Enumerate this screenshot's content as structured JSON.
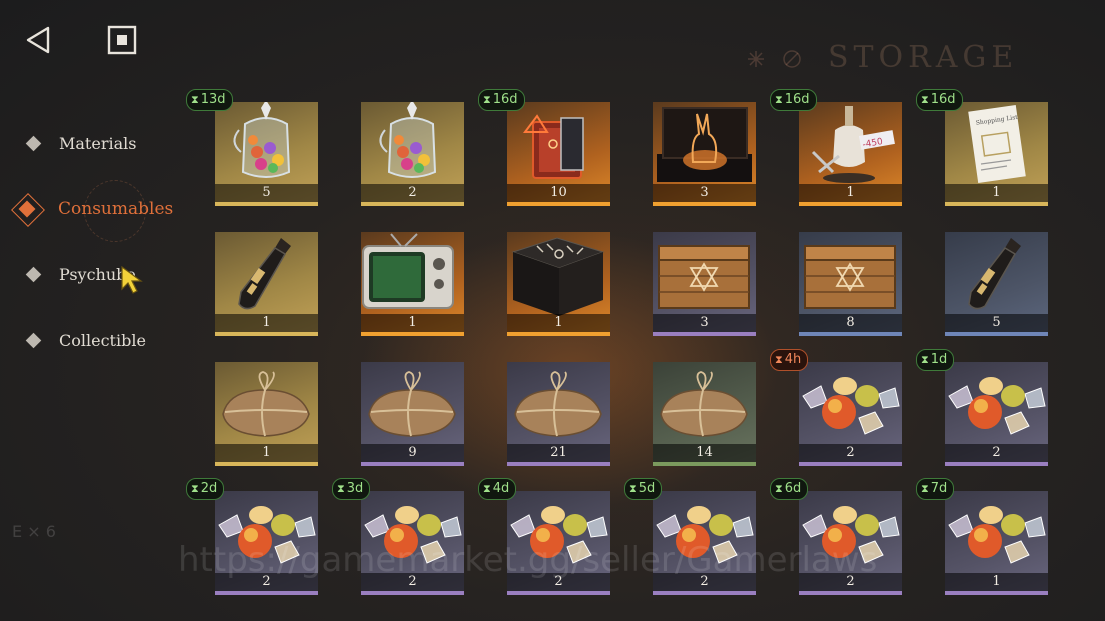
{
  "header": {
    "title": "STORAGE"
  },
  "top_buttons": {
    "back_icon": "back-triangle-icon",
    "stop_icon": "square-stop-icon"
  },
  "nav": {
    "items": [
      {
        "label": "Materials",
        "active": false
      },
      {
        "label": "Consumables",
        "active": true
      },
      {
        "label": "Psychube",
        "active": false
      },
      {
        "label": "Collectible",
        "active": false
      }
    ],
    "accent": "#e0703a"
  },
  "watermark": "https://gamemarket.gg/seller/Gamerlaws",
  "items": [
    {
      "icon": "candy-jar-icon",
      "qty": "5",
      "rarity": "gold",
      "timer": "13d"
    },
    {
      "icon": "candy-jar-icon",
      "qty": "2",
      "rarity": "gold",
      "timer": ""
    },
    {
      "icon": "spellbook-icon",
      "qty": "10",
      "rarity": "orange",
      "timer": "16d"
    },
    {
      "icon": "rabbit-figure-box-icon",
      "qty": "3",
      "rarity": "orange",
      "timer": ""
    },
    {
      "icon": "mannequin-icon",
      "qty": "1",
      "rarity": "orange",
      "timer": "16d"
    },
    {
      "icon": "shopping-list-ticket-icon",
      "qty": "1",
      "rarity": "gold",
      "timer": "16d"
    },
    {
      "icon": "message-bottle-icon",
      "qty": "1",
      "rarity": "gold",
      "timer": ""
    },
    {
      "icon": "retro-tv-icon",
      "qty": "1",
      "rarity": "orange",
      "timer": ""
    },
    {
      "icon": "rune-cube-icon",
      "qty": "1",
      "rarity": "orange",
      "timer": ""
    },
    {
      "icon": "wooden-crate-icon",
      "qty": "3",
      "rarity": "purple",
      "timer": ""
    },
    {
      "icon": "wooden-crate-icon",
      "qty": "8",
      "rarity": "blue",
      "timer": ""
    },
    {
      "icon": "message-bottle-icon",
      "qty": "5",
      "rarity": "blue",
      "timer": ""
    },
    {
      "icon": "parcel-icon",
      "qty": "1",
      "rarity": "gold",
      "timer": ""
    },
    {
      "icon": "parcel-icon",
      "qty": "9",
      "rarity": "purple",
      "timer": ""
    },
    {
      "icon": "parcel-icon",
      "qty": "21",
      "rarity": "purple",
      "timer": ""
    },
    {
      "icon": "parcel-icon",
      "qty": "14",
      "rarity": "green",
      "timer": ""
    },
    {
      "icon": "candies-icon",
      "qty": "2",
      "rarity": "purple",
      "timer": "4h",
      "timer_warn": true
    },
    {
      "icon": "candies-icon",
      "qty": "2",
      "rarity": "purple",
      "timer": "1d"
    },
    {
      "icon": "candies-icon",
      "qty": "2",
      "rarity": "purple",
      "timer": "2d"
    },
    {
      "icon": "candies-icon",
      "qty": "2",
      "rarity": "purple",
      "timer": "3d"
    },
    {
      "icon": "candies-icon",
      "qty": "2",
      "rarity": "purple",
      "timer": "4d"
    },
    {
      "icon": "candies-icon",
      "qty": "2",
      "rarity": "purple",
      "timer": "5d"
    },
    {
      "icon": "candies-icon",
      "qty": "2",
      "rarity": "purple",
      "timer": "6d"
    },
    {
      "icon": "candies-icon",
      "qty": "1",
      "rarity": "purple",
      "timer": "7d"
    }
  ]
}
